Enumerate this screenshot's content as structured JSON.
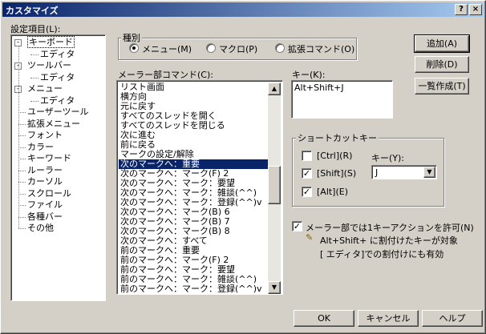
{
  "window": {
    "title": "カスタマイズ",
    "help_glyph": "?",
    "close_glyph": "×"
  },
  "settings_label": "設定項目(L):",
  "tree": [
    {
      "label": "キーボード",
      "level": 0,
      "expander": "-",
      "selected": true
    },
    {
      "label": "エディタ",
      "level": 1
    },
    {
      "label": "ツールバー",
      "level": 0,
      "expander": "-"
    },
    {
      "label": "エディタ",
      "level": 1
    },
    {
      "label": "メニュー",
      "level": 0,
      "expander": "-"
    },
    {
      "label": "エディタ",
      "level": 1
    },
    {
      "label": "ユーザーツール",
      "level": 0
    },
    {
      "label": "拡張メニュー",
      "level": 0
    },
    {
      "label": "フォント",
      "level": 0
    },
    {
      "label": "カラー",
      "level": 0
    },
    {
      "label": "キーワード",
      "level": 0
    },
    {
      "label": "ルーラー",
      "level": 0
    },
    {
      "label": "カーソル",
      "level": 0
    },
    {
      "label": "スクロール",
      "level": 0
    },
    {
      "label": "ファイル",
      "level": 0
    },
    {
      "label": "各種バー",
      "level": 0
    },
    {
      "label": "その他",
      "level": 0
    }
  ],
  "kind": {
    "title": "種別",
    "options": [
      {
        "label": "メニュー(M)",
        "checked": true
      },
      {
        "label": "マクロ(P)",
        "checked": false
      },
      {
        "label": "拡張コマンド(O)",
        "checked": false
      }
    ]
  },
  "commands": {
    "label": "メーラー部コマンド(C):",
    "items": [
      "リスト画面",
      "横方向",
      "元に戻す",
      "すべてのスレッドを開く",
      "すべてのスレッドを閉じる",
      "次に進む",
      "前に戻る",
      "マークの設定/解除",
      "次のマークへ：重要",
      "次のマークへ：マーク(F) 2",
      "次のマークへ：マーク：要望",
      "次のマークへ：マーク：雑談(^^)",
      "次のマークへ：マーク：登録(^^)v",
      "次のマークへ：マーク(B) 6",
      "次のマークへ：マーク(B) 7",
      "次のマークへ：マーク(B) 8",
      "次のマークへ：すべて",
      "前のマークへ：重要",
      "前のマークへ：マーク(F) 2",
      "前のマークへ：マーク：要望",
      "前のマークへ：マーク：雑談(^^)",
      "前のマークへ：マーク：登録(^^)v"
    ],
    "selected_index": 8
  },
  "key": {
    "label": "キー(K):",
    "value": "Alt+Shift+J"
  },
  "shortcut": {
    "title": "ショートカットキー",
    "ctrl": {
      "label": "[Ctrl](R)",
      "checked": false
    },
    "shift": {
      "label": "[Shift](S)",
      "checked": true
    },
    "alt": {
      "label": "[Alt](E)",
      "checked": true
    },
    "key_label": "キー(Y):",
    "key_value": "J"
  },
  "buttons": {
    "add": "追加(A)",
    "delete": "削除(D)",
    "list": "一覧作成(T)"
  },
  "allow": {
    "label": "メーラー部では1キーアクションを許可(N)",
    "checked": true,
    "note1": "Alt+Shift+ に割付けたキーが対象",
    "note2": "[ エディタ]での割付けにも有効"
  },
  "footer": {
    "ok": "OK",
    "cancel": "キャンセル",
    "help": "ヘルプ"
  }
}
